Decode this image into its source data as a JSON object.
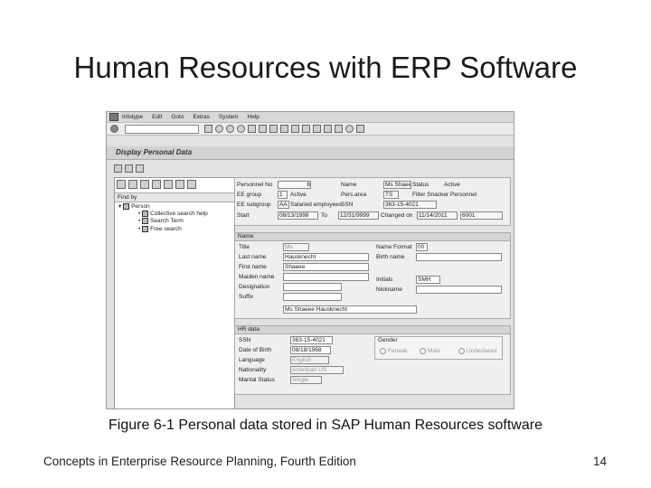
{
  "slide": {
    "title": "Human Resources with ERP Software",
    "caption": "Figure 6-1  Personal data stored in SAP Human Resources software",
    "footer": "Concepts in Enterprise Resource Planning, Fourth Edition",
    "page_number": "14"
  },
  "sap": {
    "menu": [
      "Infotype",
      "Edit",
      "Goto",
      "Extras",
      "System",
      "Help"
    ],
    "window_title": "Display Personal Data",
    "nav": {
      "header": "Find by",
      "root": "Person",
      "items": [
        "Collective search help",
        "Search Term",
        "Free search"
      ]
    },
    "header_fields": {
      "personnel_no_label": "Personnel No",
      "personnel_no": "6",
      "name_label": "Name",
      "name": "Ms Shaee",
      "status_label": "Status",
      "status": "Active",
      "ee_group_label": "EE group",
      "ee_group_code": "1",
      "ee_group": "Active",
      "pers_area_label": "Pers.area",
      "pers_area_code": "TS",
      "pers_area": "Filter Snacker Personnel",
      "ee_subgroup_label": "EE subgroup",
      "ee_subgroup_code": "AA",
      "ee_subgroup": "Salaried employees",
      "ssn_label": "SSN",
      "ssn": "363-15-4021",
      "start_label": "Start",
      "start": "08/13/1998",
      "to_label": "To",
      "to": "12/31/9999",
      "changed_on_label": "Changed on",
      "changed_on": "11/14/2011",
      "changed_by": "6001"
    },
    "name_section": {
      "header": "Name",
      "title_label": "Title",
      "title_value": "Ms",
      "last_name_label": "Last name",
      "last_name": "Hausknecht",
      "first_name_label": "First name",
      "first_name": "Shaeee",
      "maiden_name_label": "Maiden name",
      "designation_label": "Designation",
      "suffix_label": "Suffix",
      "name_format_label": "Name Format",
      "name_format": "00",
      "birth_name_label": "Birth name",
      "initials_label": "Initials",
      "initials": "SMH",
      "nickname_label": "Nickname",
      "full_name": "Ms Shaeee Hausknecht"
    },
    "hr_section": {
      "header": "HR data",
      "ssn_label": "SSN",
      "ssn": "363-15-4021",
      "dob_label": "Date of Birth",
      "dob": "08/18/1968",
      "language_label": "Language",
      "language": "English",
      "nationality_label": "Nationality",
      "nationality": "American US",
      "marital_label": "Marital Status",
      "marital": "Single",
      "gender_header": "Gender",
      "gender_options": [
        "Female",
        "Male",
        "Undeclared"
      ]
    }
  }
}
